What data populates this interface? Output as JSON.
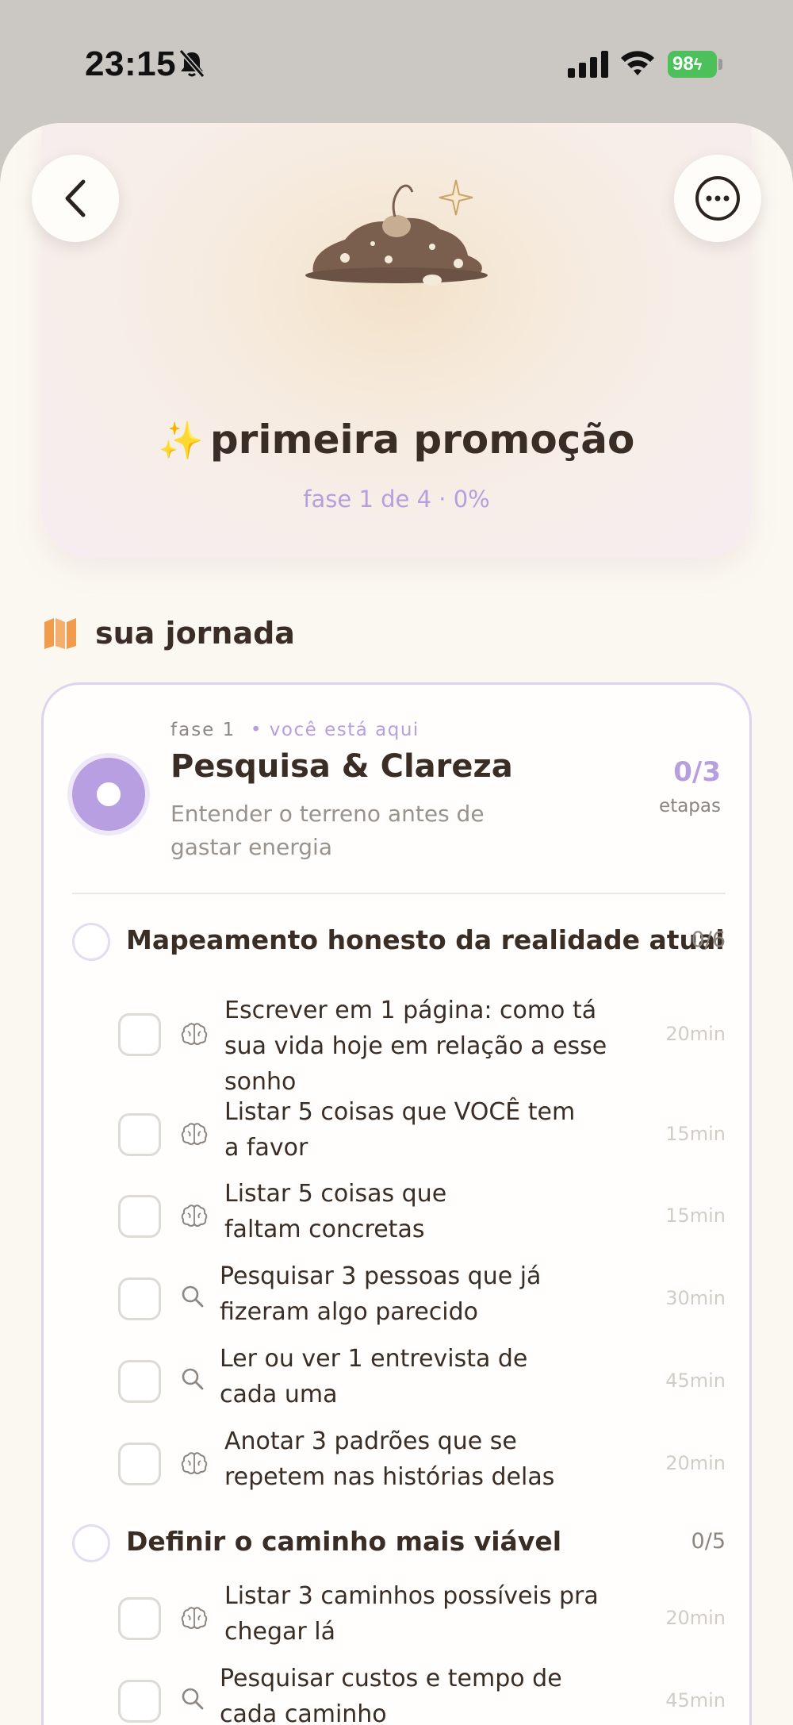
{
  "status_bar": {
    "time": "23:15",
    "battery": "98",
    "icons": [
      "bell-slash-icon",
      "signal-icon",
      "wifi-icon",
      "battery-icon"
    ]
  },
  "header": {
    "back_icon": "chevron-left-icon",
    "more_icon": "ellipsis-icon",
    "illustration": "seed-sprout-mound",
    "emoji": "✨",
    "title": "primeira promoção",
    "subtitle": "fase 1 de 4 · 0%"
  },
  "journey": {
    "icon": "map-icon",
    "title": "sua jornada"
  },
  "phase": {
    "label": "fase 1",
    "here": "• você está aqui",
    "title": "Pesquisa & Clareza",
    "description": "Entender o terreno antes de gastar energia",
    "count": "0/3",
    "count_label": "etapas"
  },
  "groups": [
    {
      "title": "Mapeamento honesto da realidade atual",
      "count": "0/6",
      "tasks": [
        {
          "icon": "brain-icon",
          "text": "Escrever em 1 página: como tá sua vida hoje em relação a esse sonho",
          "time": "20min"
        },
        {
          "icon": "brain-icon",
          "text": "Listar 5 coisas que VOCÊ tem a favor",
          "time": "15min"
        },
        {
          "icon": "brain-icon",
          "text": "Listar 5 coisas que faltam concretas",
          "time": "15min"
        },
        {
          "icon": "search-icon",
          "text": "Pesquisar 3 pessoas que já fizeram algo parecido",
          "time": "30min"
        },
        {
          "icon": "search-icon",
          "text": "Ler ou ver 1 entrevista de cada uma",
          "time": "45min"
        },
        {
          "icon": "brain-icon",
          "text": "Anotar 3 padrões que se repetem nas histórias delas",
          "time": "20min"
        }
      ]
    },
    {
      "title": "Definir o caminho mais viável",
      "count": "0/5",
      "tasks": [
        {
          "icon": "brain-icon",
          "text": "Listar 3 caminhos possíveis pra chegar lá",
          "time": "20min"
        },
        {
          "icon": "search-icon",
          "text": "Pesquisar custos e tempo de cada caminho",
          "time": "45min"
        }
      ]
    }
  ]
}
